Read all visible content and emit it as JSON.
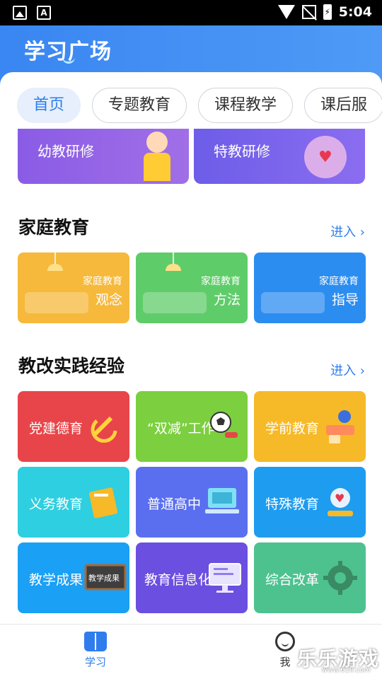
{
  "status_bar": {
    "time": "5:04",
    "battery_glyph": "⚡"
  },
  "header": {
    "title": "学习广场"
  },
  "tabs": [
    {
      "label": "首页",
      "active": true
    },
    {
      "label": "专题教育",
      "active": false
    },
    {
      "label": "课程教学",
      "active": false
    },
    {
      "label": "课后服",
      "active": false
    }
  ],
  "top_cards": [
    {
      "label": "幼教研修"
    },
    {
      "label": "特教研修"
    }
  ],
  "family_section": {
    "title": "家庭教育",
    "more": "进入 ›",
    "cards": [
      {
        "small": "家庭教育",
        "big": "观念",
        "color": "#f6b93b"
      },
      {
        "small": "家庭教育",
        "big": "方法",
        "color": "#5fcc6a"
      },
      {
        "small": "家庭教育",
        "big": "指导",
        "color": "#2c8df0"
      }
    ]
  },
  "reform_section": {
    "title": "教改实践经验",
    "more": "进入 ›",
    "cards": [
      {
        "label": "党建德育",
        "color": "#e8454a",
        "icon": "hammer-sickle-icon"
      },
      {
        "label": "“双减”工作",
        "color": "#7ccf3f",
        "icon": "soccer-ball-icon"
      },
      {
        "label": "学前教育",
        "color": "#f6b928",
        "icon": "globe-toy-icon"
      },
      {
        "label": "义务教育",
        "color": "#2ecfe0",
        "icon": "books-icon"
      },
      {
        "label": "普通高中",
        "color": "#5a6ff0",
        "icon": "computer-icon"
      },
      {
        "label": "特殊教育",
        "color": "#1e9cf0",
        "icon": "heart-hands-icon"
      },
      {
        "label": "教学成果",
        "color": "#1aa0f5",
        "icon": "blackboard-icon"
      },
      {
        "label": "教育信息化",
        "color": "#6b4fe0",
        "icon": "monitor-icon"
      },
      {
        "label": "综合改革",
        "color": "#4dc28f",
        "icon": "gear-icon"
      }
    ],
    "blackboard_text": "教学成果"
  },
  "bottom_nav": [
    {
      "label": "学习",
      "icon": "book-icon",
      "active": true
    },
    {
      "label": "我",
      "icon": "profile-icon",
      "active": false
    }
  ],
  "watermark": {
    "text": "乐乐游戏",
    "url": "www.61ll.com"
  }
}
